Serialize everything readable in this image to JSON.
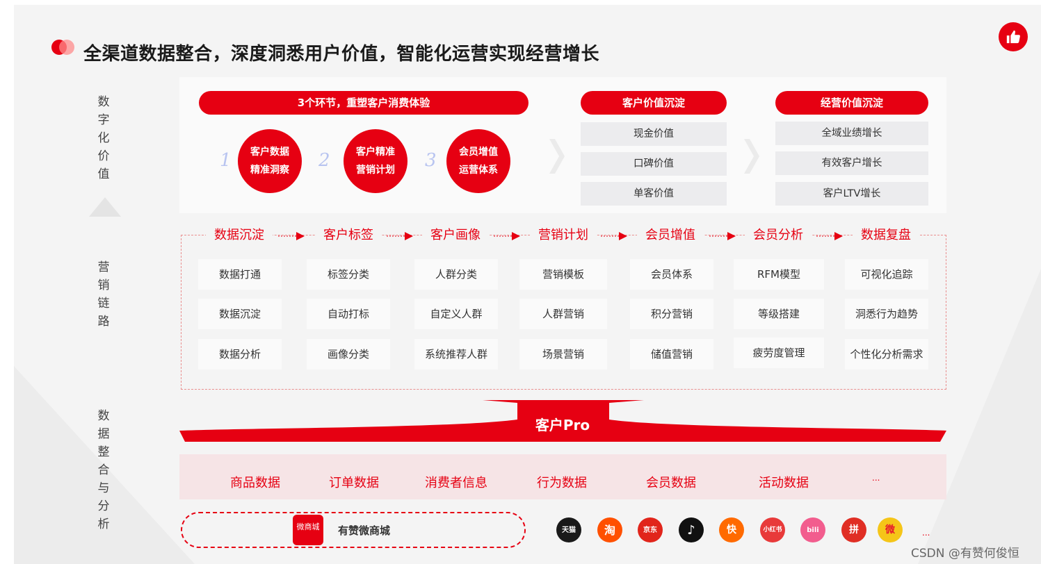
{
  "title": "全渠道数据整合，深度洞悉用户价值，智能化运营实现经营增长",
  "side_labels": [
    "数字化价值",
    "营销链路",
    "数据整合与分析"
  ],
  "experience": {
    "banner": "3个环节，重塑客户消费体验",
    "steps": [
      {
        "num": "1",
        "line1": "客户数据",
        "line2": "精准洞察"
      },
      {
        "num": "2",
        "line1": "客户精准",
        "line2": "营销计划"
      },
      {
        "num": "3",
        "line1": "会员增值",
        "line2": "运营体系"
      }
    ]
  },
  "customer_value": {
    "header": "客户价值沉淀",
    "items": [
      "现金价值",
      "口碑价值",
      "单客价值"
    ]
  },
  "business_value": {
    "header": "经营价值沉淀",
    "items": [
      "全域业绩增长",
      "有效客户增长",
      "客户LTV增长"
    ]
  },
  "marketing_chain": {
    "stages": [
      {
        "name": "数据沉淀",
        "items": [
          "数据打通",
          "数据沉淀",
          "数据分析"
        ]
      },
      {
        "name": "客户标签",
        "items": [
          "标签分类",
          "自动打标",
          "画像分类"
        ]
      },
      {
        "name": "客户画像",
        "items": [
          "人群分类",
          "自定义人群",
          "系统推荐人群"
        ]
      },
      {
        "name": "营销计划",
        "items": [
          "营销模板",
          "人群营销",
          "场景营销"
        ]
      },
      {
        "name": "会员增值",
        "items": [
          "会员体系",
          "积分营销",
          "储值营销"
        ]
      },
      {
        "name": "会员分析",
        "items": [
          "RFM模型",
          "等级搭建",
          "疲劳度管理"
        ]
      },
      {
        "name": "数据复盘",
        "items": [
          "可视化追踪",
          "洞悉行为趋势",
          "个性化分析需求"
        ]
      }
    ]
  },
  "pro_label": "客户Pro",
  "data_sources": [
    "商品数据",
    "订单数据",
    "消费者信息",
    "行为数据",
    "会员数据",
    "活动数据",
    "..."
  ],
  "youzan": {
    "logo_text": "微商城",
    "label": "有赞微商城"
  },
  "platforms": [
    {
      "icon": "tmall-icon",
      "text": "天猫",
      "color": "#1a1a1a"
    },
    {
      "icon": "taobao-icon",
      "text": "淘",
      "color": "#ff5000"
    },
    {
      "icon": "jd-icon",
      "text": "京东",
      "color": "#e1251b"
    },
    {
      "icon": "douyin-icon",
      "text": "♪",
      "color": "#111111"
    },
    {
      "icon": "kuaishou-icon",
      "text": "快",
      "color": "#ff6a00"
    },
    {
      "icon": "xiaohongshu-icon",
      "text": "小红书",
      "color": "#e83a3a"
    },
    {
      "icon": "bilibili-icon",
      "text": "bili",
      "color": "#f25d8e"
    },
    {
      "icon": "pinduoduo-icon",
      "text": "拼",
      "color": "#e02e24"
    },
    {
      "icon": "weibo-icon",
      "text": "微",
      "color": "#f5c518"
    }
  ],
  "platform_more": "...",
  "watermark": "CSDN @有赞何俊恒"
}
